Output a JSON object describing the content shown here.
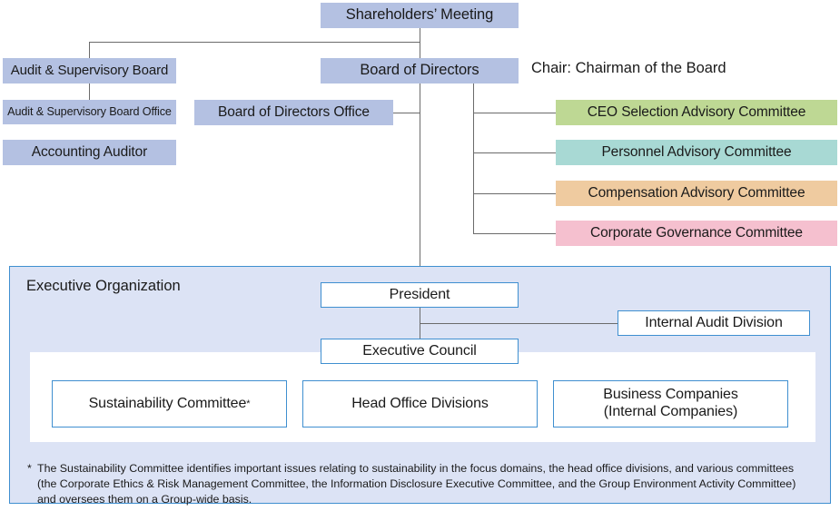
{
  "diagram": {
    "title": "Corporate Governance Organization Chart",
    "colors": {
      "box_blue": "#b4c1e2",
      "box_green": "#bed894",
      "box_teal": "#a8d9d4",
      "box_orange": "#efcba0",
      "box_pink": "#f5c0cf",
      "panel_bg": "#dce3f5",
      "outline_blue": "#3f8fd0",
      "line_gray": "#6b6b6b",
      "text": "#1a1a1a",
      "white": "#ffffff"
    },
    "nodes": {
      "shareholders_meeting": "Shareholders’ Meeting",
      "audit_supervisory_board": "Audit & Supervisory Board",
      "audit_supervisory_board_office": "Audit & Supervisory Board Office",
      "accounting_auditor": "Accounting Auditor",
      "board_of_directors": "Board of Directors",
      "board_of_directors_office": "Board of Directors Office",
      "ceo_selection_advisory_committee": "CEO Selection Advisory Committee",
      "personnel_advisory_committee": "Personnel Advisory Committee",
      "compensation_advisory_committee": "Compensation Advisory Committee",
      "corporate_governance_committee": "Corporate Governance Committee",
      "president": "President",
      "internal_audit_division": "Internal Audit Division",
      "executive_council": "Executive Council",
      "sustainability_committee": "Sustainability Committee",
      "head_office_divisions": "Head Office Divisions",
      "business_companies_line1": "Business Companies",
      "business_companies_line2": "(Internal Companies)"
    },
    "labels": {
      "chair_note": "Chair: Chairman of the Board",
      "executive_organization": "Executive Organization",
      "footnote_marker": "*",
      "footnote_text": "The Sustainability Committee identifies important issues relating to sustainability in the focus domains, the head office divisions, and various committees (the Corporate Ethics & Risk Management Committee, the Information Disclosure Executive Committee, and the Group Environment Activity Committee) and oversees them on a Group-wide basis."
    }
  }
}
